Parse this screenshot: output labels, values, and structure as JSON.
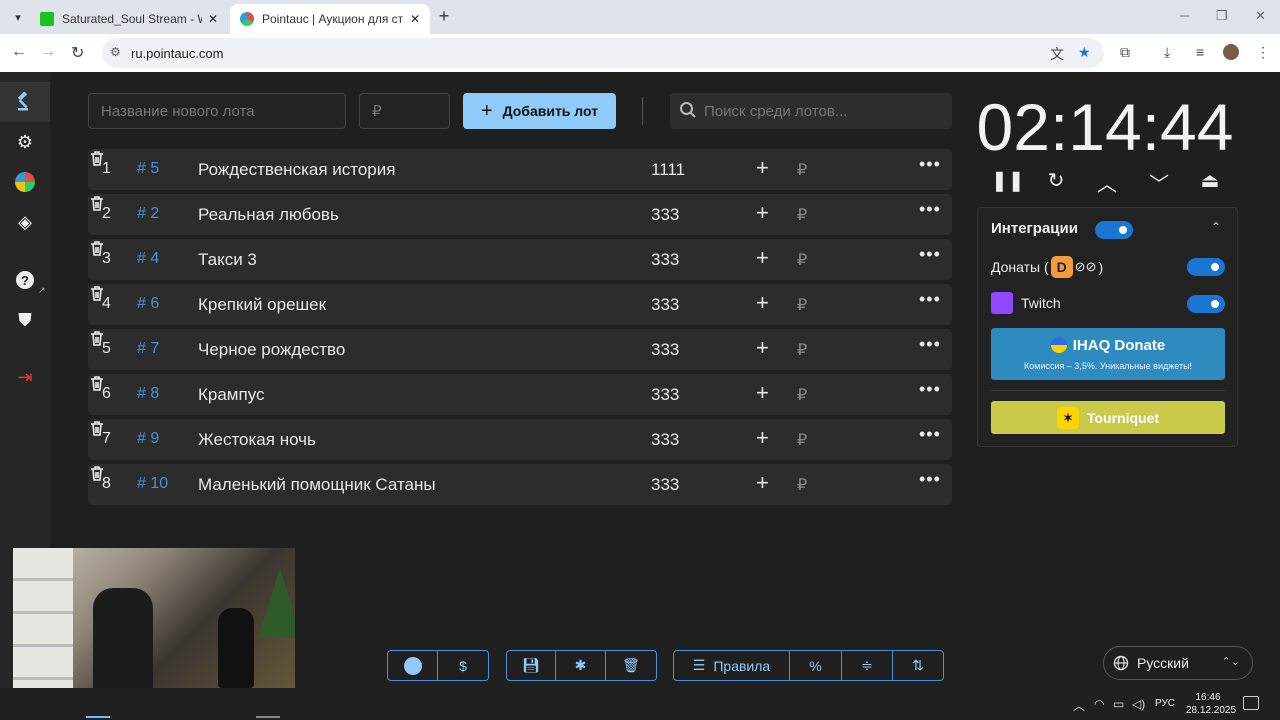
{
  "browser": {
    "tabs": [
      {
        "title": "Saturated_Soul Stream - Watch",
        "favicon_color": "#18c41b"
      },
      {
        "title": "Pointauc | Аукцион для стриме",
        "favicon_color": "#6a5acd"
      }
    ],
    "url": "ru.pointauc.com"
  },
  "toolbar": {
    "new_lot_placeholder": "Название нового лота",
    "price_placeholder": "₽",
    "add_button_label": "Добавить лот",
    "search_placeholder": "Поиск среди лотов..."
  },
  "lots": [
    {
      "index": "1",
      "id": "# 5",
      "name": "Рождественская история",
      "amount": "1111",
      "currency": "₽"
    },
    {
      "index": "2",
      "id": "# 2",
      "name": "Реальная любовь",
      "amount": "333",
      "currency": "₽"
    },
    {
      "index": "3",
      "id": "# 4",
      "name": "Такси 3",
      "amount": "333",
      "currency": "₽"
    },
    {
      "index": "4",
      "id": "# 6",
      "name": "Крепкий орешек",
      "amount": "333",
      "currency": "₽"
    },
    {
      "index": "5",
      "id": "# 7",
      "name": "Черное рождество",
      "amount": "333",
      "currency": "₽"
    },
    {
      "index": "6",
      "id": "# 8",
      "name": "Крампус",
      "amount": "333",
      "currency": "₽"
    },
    {
      "index": "7",
      "id": "# 9",
      "name": "Жестокая ночь",
      "amount": "333",
      "currency": "₽"
    },
    {
      "index": "8",
      "id": "# 10",
      "name": "Маленький помощник Сатаны",
      "amount": "333",
      "currency": "₽"
    }
  ],
  "timer": {
    "value": "02:14:44"
  },
  "integrations": {
    "title": "Интеграции",
    "enabled": true,
    "donations_label": "Донаты (",
    "donations_close": ")",
    "donations_logo_letter": "D",
    "donations_glyph": "⊘⊘",
    "donations_enabled": true,
    "twitch_label": "Twitch",
    "twitch_enabled": true,
    "ihaq_title": "IHAQ Donate",
    "ihaq_subtitle": "Комиссия – 3,5%. Уникальные виджеты!",
    "tourniquet_label": "Tourniquet"
  },
  "bottom_bar": {
    "github_icon": "github-icon",
    "dollar": "$",
    "rules_label": "Правила",
    "percent": "%"
  },
  "language": {
    "value": "Русский"
  },
  "taskbar": {
    "lang": "РУС",
    "time": "16:46",
    "date": "28.12.2025"
  },
  "colors": {
    "accent": "#90caf9",
    "id_blue": "#4a90d9",
    "toggle": "#1976d2",
    "ihaq": "#2e8bc0",
    "tourniquet": "#c9c94a"
  }
}
